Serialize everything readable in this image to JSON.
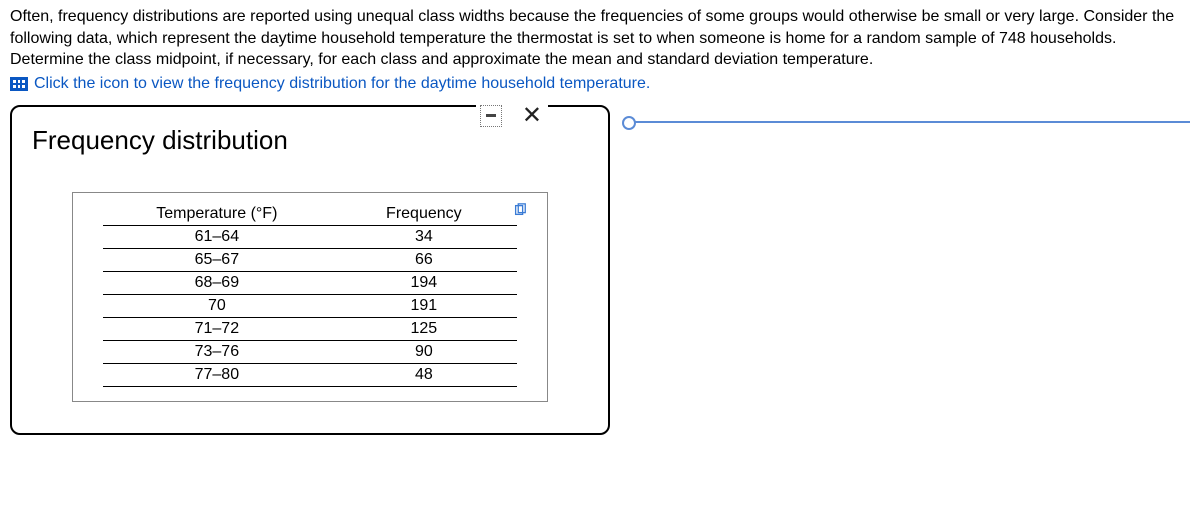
{
  "intro_text": "Often, frequency distributions are reported using unequal class widths because the frequencies of some groups would otherwise be small or very large. Consider the following data, which represent the daytime household temperature the thermostat is set to when someone is home for a random sample of 748 households. Determine the class midpoint, if necessary, for each class and approximate the mean and standard deviation temperature.",
  "link_text": "Click the icon to view the frequency distribution for the daytime household temperature.",
  "dialog": {
    "title": "Frequency distribution",
    "table": {
      "header_col1_label": "Temperature",
      "header_col1_unit": "(°F)",
      "header_col2": "Frequency",
      "rows": [
        {
          "range": "61–64",
          "freq": "34"
        },
        {
          "range": "65–67",
          "freq": "66"
        },
        {
          "range": "68–69",
          "freq": "194"
        },
        {
          "range": "70",
          "freq": "191"
        },
        {
          "range": "71–72",
          "freq": "125"
        },
        {
          "range": "73–76",
          "freq": "90"
        },
        {
          "range": "77–80",
          "freq": "48"
        }
      ]
    }
  }
}
